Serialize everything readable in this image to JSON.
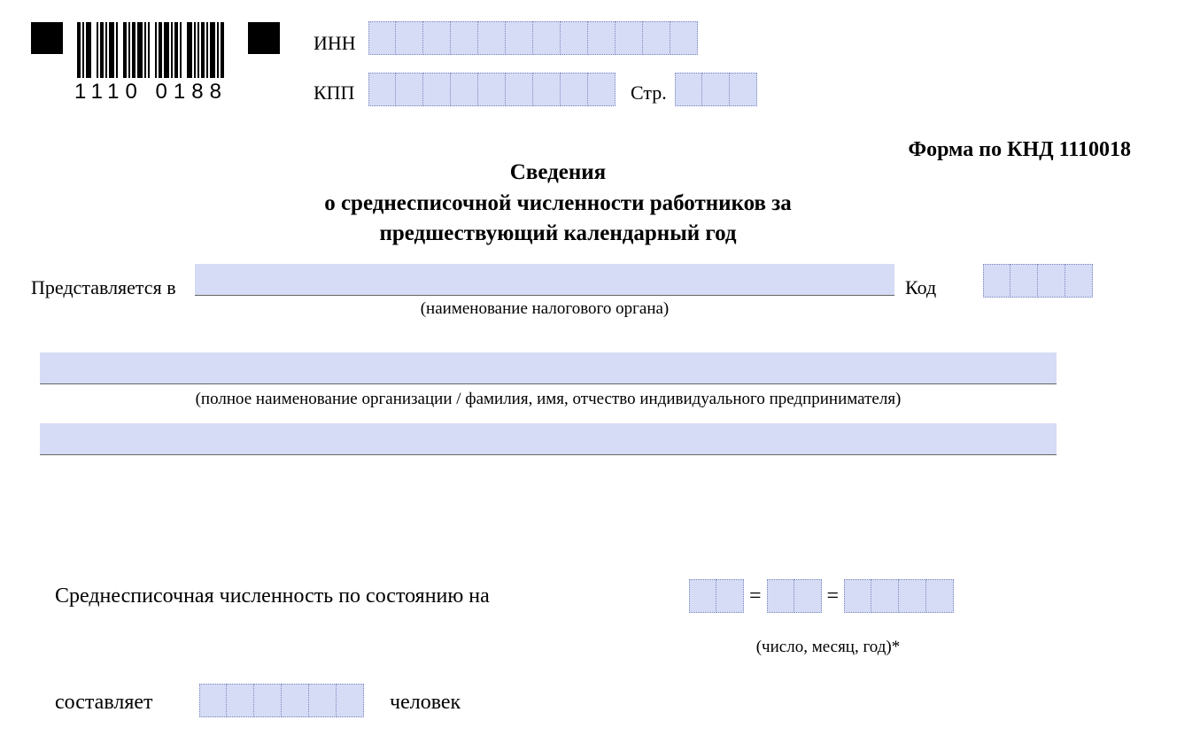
{
  "header": {
    "barcode_digits": "1110 0188",
    "inn_label": "ИНН",
    "kpp_label": "КПП",
    "page_label": "Стр.",
    "cells": {
      "inn": 12,
      "kpp": 9,
      "page": 3
    }
  },
  "form_code": "Форма по КНД 1110018",
  "title": {
    "line1": "Сведения",
    "line2": "о среднесписочной численности работников за",
    "line3": "предшествующий календарный год"
  },
  "submit_to": {
    "label": "Представляется в",
    "caption": "(наименование налогового органа)",
    "code_label": "Код",
    "code_cells": 4
  },
  "org_name": {
    "caption": "(полное наименование организации / фамилия, имя, отчество индивидуального предпринимателя)"
  },
  "headcount": {
    "label": "Среднесписочная численность по состоянию на",
    "sep": "=",
    "date_cells": {
      "day": 2,
      "month": 2,
      "year": 4
    },
    "date_caption": "(число, месяц, год)*",
    "amount_label": "составляет",
    "amount_cells": 6,
    "unit_label": "человек"
  }
}
